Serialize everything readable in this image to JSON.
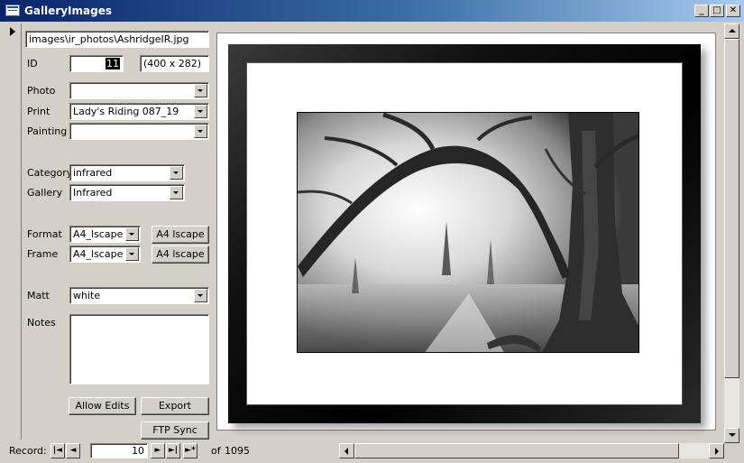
{
  "window": {
    "title": "GalleryImages",
    "buttons": {
      "minimize": "_",
      "maximize": "□",
      "close": "✕"
    }
  },
  "form": {
    "path": "images\\ir_photos\\AshridgeIR.jpg",
    "id_label": "ID",
    "id_value": "11",
    "dimensions": "(400 x 282)",
    "photo_label": "Photo",
    "photo_value": "",
    "print_label": "Print",
    "print_value": "Lady's Riding 087_19",
    "painting_label": "Painting",
    "painting_value": "",
    "category_label": "Category",
    "category_value": "infrared",
    "gallery_label": "Gallery",
    "gallery_value": "Infrared",
    "format_label": "Format",
    "format_value": "A4_lscape",
    "format_button": "A4 lscape",
    "frame_label": "Frame",
    "frame_value": "A4_lscape",
    "frame_button": "A4 lscape",
    "matt_label": "Matt",
    "matt_value": "white",
    "notes_label": "Notes",
    "notes_value": "",
    "allow_edits_button": "Allow Edits",
    "export_button": "Export",
    "ftp_sync_button": "FTP Sync"
  },
  "navigation": {
    "record_label": "Record:",
    "first": "|◄",
    "prev": "◄",
    "current": "10",
    "next": "►",
    "last": "►|",
    "new": "►*",
    "of_label": "of",
    "total": "1095"
  },
  "icons": {
    "app": "form-icon",
    "selector": "record-selector-arrow-icon"
  }
}
